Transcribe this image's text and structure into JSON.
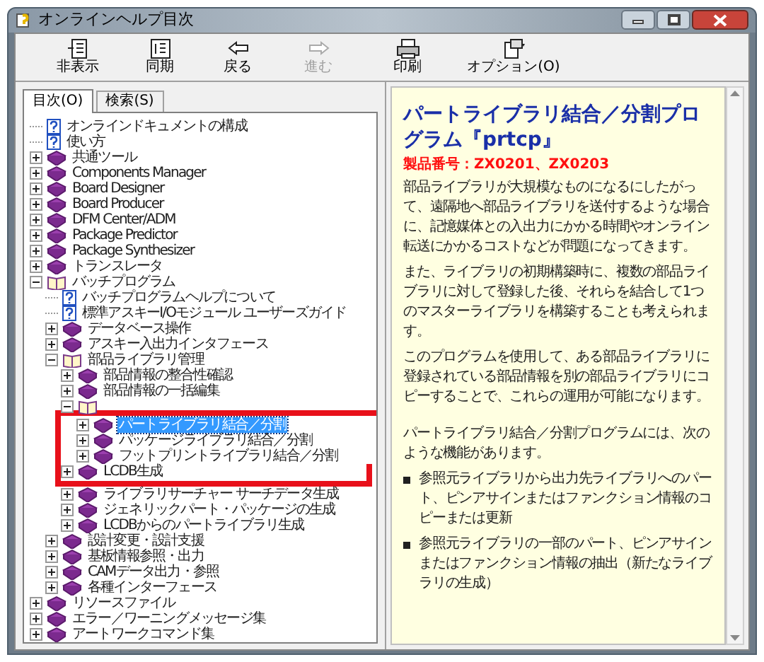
{
  "window": {
    "title": "オンラインヘルプ目次"
  },
  "toolbar": [
    {
      "label": "非表示",
      "disabled": false
    },
    {
      "label": "同期",
      "disabled": false
    },
    {
      "label": "戻る",
      "disabled": false
    },
    {
      "label": "進む",
      "disabled": true
    },
    {
      "label": "印刷",
      "disabled": false
    },
    {
      "label": "オプション(O)",
      "disabled": false
    }
  ],
  "tabs": [
    {
      "label": "目次(O)",
      "selected": true
    },
    {
      "label": "検索(S)",
      "selected": false
    }
  ],
  "tree": [
    {
      "label": "オンラインドキュメントの構成",
      "kind": "page",
      "selected": false
    },
    {
      "label": "使い方",
      "kind": "page",
      "selected": false
    },
    {
      "label": "共通ツール",
      "kind": "book",
      "expanded": false,
      "selected": false
    },
    {
      "label": "Components Manager",
      "kind": "book",
      "expanded": false,
      "selected": false
    },
    {
      "label": "Board Designer",
      "kind": "book",
      "expanded": false,
      "selected": false
    },
    {
      "label": "Board Producer",
      "kind": "book",
      "expanded": false,
      "selected": false
    },
    {
      "label": "DFM Center/ADM",
      "kind": "book",
      "expanded": false,
      "selected": false
    },
    {
      "label": "Package Predictor",
      "kind": "book",
      "expanded": false,
      "selected": false
    },
    {
      "label": "Package Synthesizer",
      "kind": "book",
      "expanded": false,
      "selected": false
    },
    {
      "label": "トランスレータ",
      "kind": "book",
      "expanded": false,
      "selected": false
    },
    {
      "label": "バッチプログラム",
      "kind": "book",
      "expanded": true,
      "selected": false,
      "children": [
        {
          "label": "バッチプログラムヘルプについて",
          "kind": "page",
          "selected": false
        },
        {
          "label": "標準アスキーI/Oモジュール ユーザーズガイド",
          "kind": "page",
          "selected": false
        },
        {
          "label": "データベース操作",
          "kind": "book",
          "expanded": false,
          "selected": false
        },
        {
          "label": "アスキー入出力インタフェース",
          "kind": "book",
          "expanded": false,
          "selected": false
        },
        {
          "label": "部品ライブラリ管理",
          "kind": "book",
          "expanded": true,
          "selected": false,
          "children": [
            {
              "label": "部品情報の整合性確認",
              "kind": "book",
              "expanded": false,
              "selected": false
            },
            {
              "label": "部品情報の一括編集",
              "kind": "book",
              "expanded": false,
              "selected": false
            },
            {
              "kind": "book",
              "expanded": true,
              "children": [
                {
                  "label": "パートライブラリ結合／分割",
                  "kind": "book",
                  "expanded": false,
                  "selected": true,
                  "highlight": true
                },
                {
                  "label": "パッケージライブラリ結合／分割",
                  "kind": "book",
                  "expanded": false,
                  "selected": false,
                  "highlight": true
                },
                {
                  "label": "フットプリントライブラリ結合／分割",
                  "kind": "book",
                  "expanded": false,
                  "selected": false,
                  "highlight": true
                }
              ]
            },
            {
              "label": "LCDB生成",
              "kind": "book",
              "expanded": false,
              "selected": false,
              "highlight": true
            },
            {
              "label": "ライブラリサーチャー サーチデータ生成",
              "kind": "book",
              "expanded": false,
              "selected": false
            },
            {
              "label": "ジェネリックパート・パッケージの生成",
              "kind": "book",
              "expanded": false,
              "selected": false
            },
            {
              "label": "LCDBからのパートライブラリ生成",
              "kind": "book",
              "expanded": false,
              "selected": false
            }
          ]
        },
        {
          "label": "設計変更・設計支援",
          "kind": "book",
          "expanded": false,
          "selected": false
        },
        {
          "label": "基板情報参照・出力",
          "kind": "book",
          "expanded": false,
          "selected": false
        },
        {
          "label": "CAMデータ出力・参照",
          "kind": "book",
          "expanded": false,
          "selected": false
        },
        {
          "label": "各種インターフェース",
          "kind": "book",
          "expanded": false,
          "selected": false
        }
      ]
    },
    {
      "label": "リソースファイル",
      "kind": "book",
      "expanded": false,
      "selected": false
    },
    {
      "label": "エラー／ワーニングメッセージ集",
      "kind": "book",
      "expanded": false,
      "selected": false
    },
    {
      "label": "アートワークコマンド集",
      "kind": "book",
      "expanded": false,
      "selected": false
    }
  ],
  "content": {
    "title": "パートライブラリ結合／分割プログラム『prtcp』",
    "product_number": "製品番号：ZX0201、ZX0203",
    "paragraphs": [
      "部品ライブラリが大規模なものになるにしたがって、遠隔地へ部品ライブラリを送付するような場合に、記憶媒体との入出力にかかる時間やオンライン転送にかかるコストなどが問題になってきます。",
      "また、ライブラリの初期構築時に、複数の部品ライブラリに対して登録した後、それらを結合して1つのマスターライブラリを構築することも考えられます。",
      "このプログラムを使用して、ある部品ライブラリに登録されている部品情報を別の部品ライブラリにコピーすることで、これらの運用が可能になります。",
      "パートライブラリ結合／分割プログラムには、次のような機能があります。"
    ],
    "bullets": [
      "参照元ライブラリから出力先ライブラリへのパート、ピンアサインまたはファンクション情報のコピーまたは更新",
      "参照元ライブラリの一部のパート、ピンアサインまたはファンクション情報の抽出（新たなライブラリの生成）"
    ]
  }
}
